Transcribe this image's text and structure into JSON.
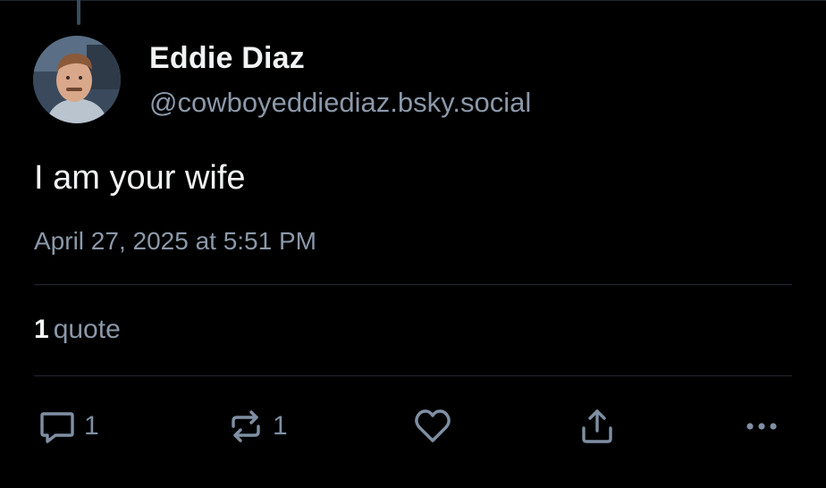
{
  "post": {
    "author": {
      "display_name": "Eddie Diaz",
      "handle": "@cowboyeddiediaz.bsky.social"
    },
    "text": "I am your wife",
    "timestamp": "April 27, 2025 at 5:51 PM",
    "stats": {
      "quote_count": "1",
      "quote_label": "quote"
    },
    "actions": {
      "reply_count": "1",
      "repost_count": "1"
    }
  },
  "colors": {
    "background": "#000000",
    "text_primary": "#f1f3f5",
    "text_secondary": "#8b98a9",
    "icon": "#7f8fa3"
  },
  "icons": {
    "reply": "comment-bubble-icon",
    "repost": "repost-arrows-icon",
    "like": "heart-icon",
    "share": "share-upload-icon",
    "more": "more-dots-icon"
  }
}
